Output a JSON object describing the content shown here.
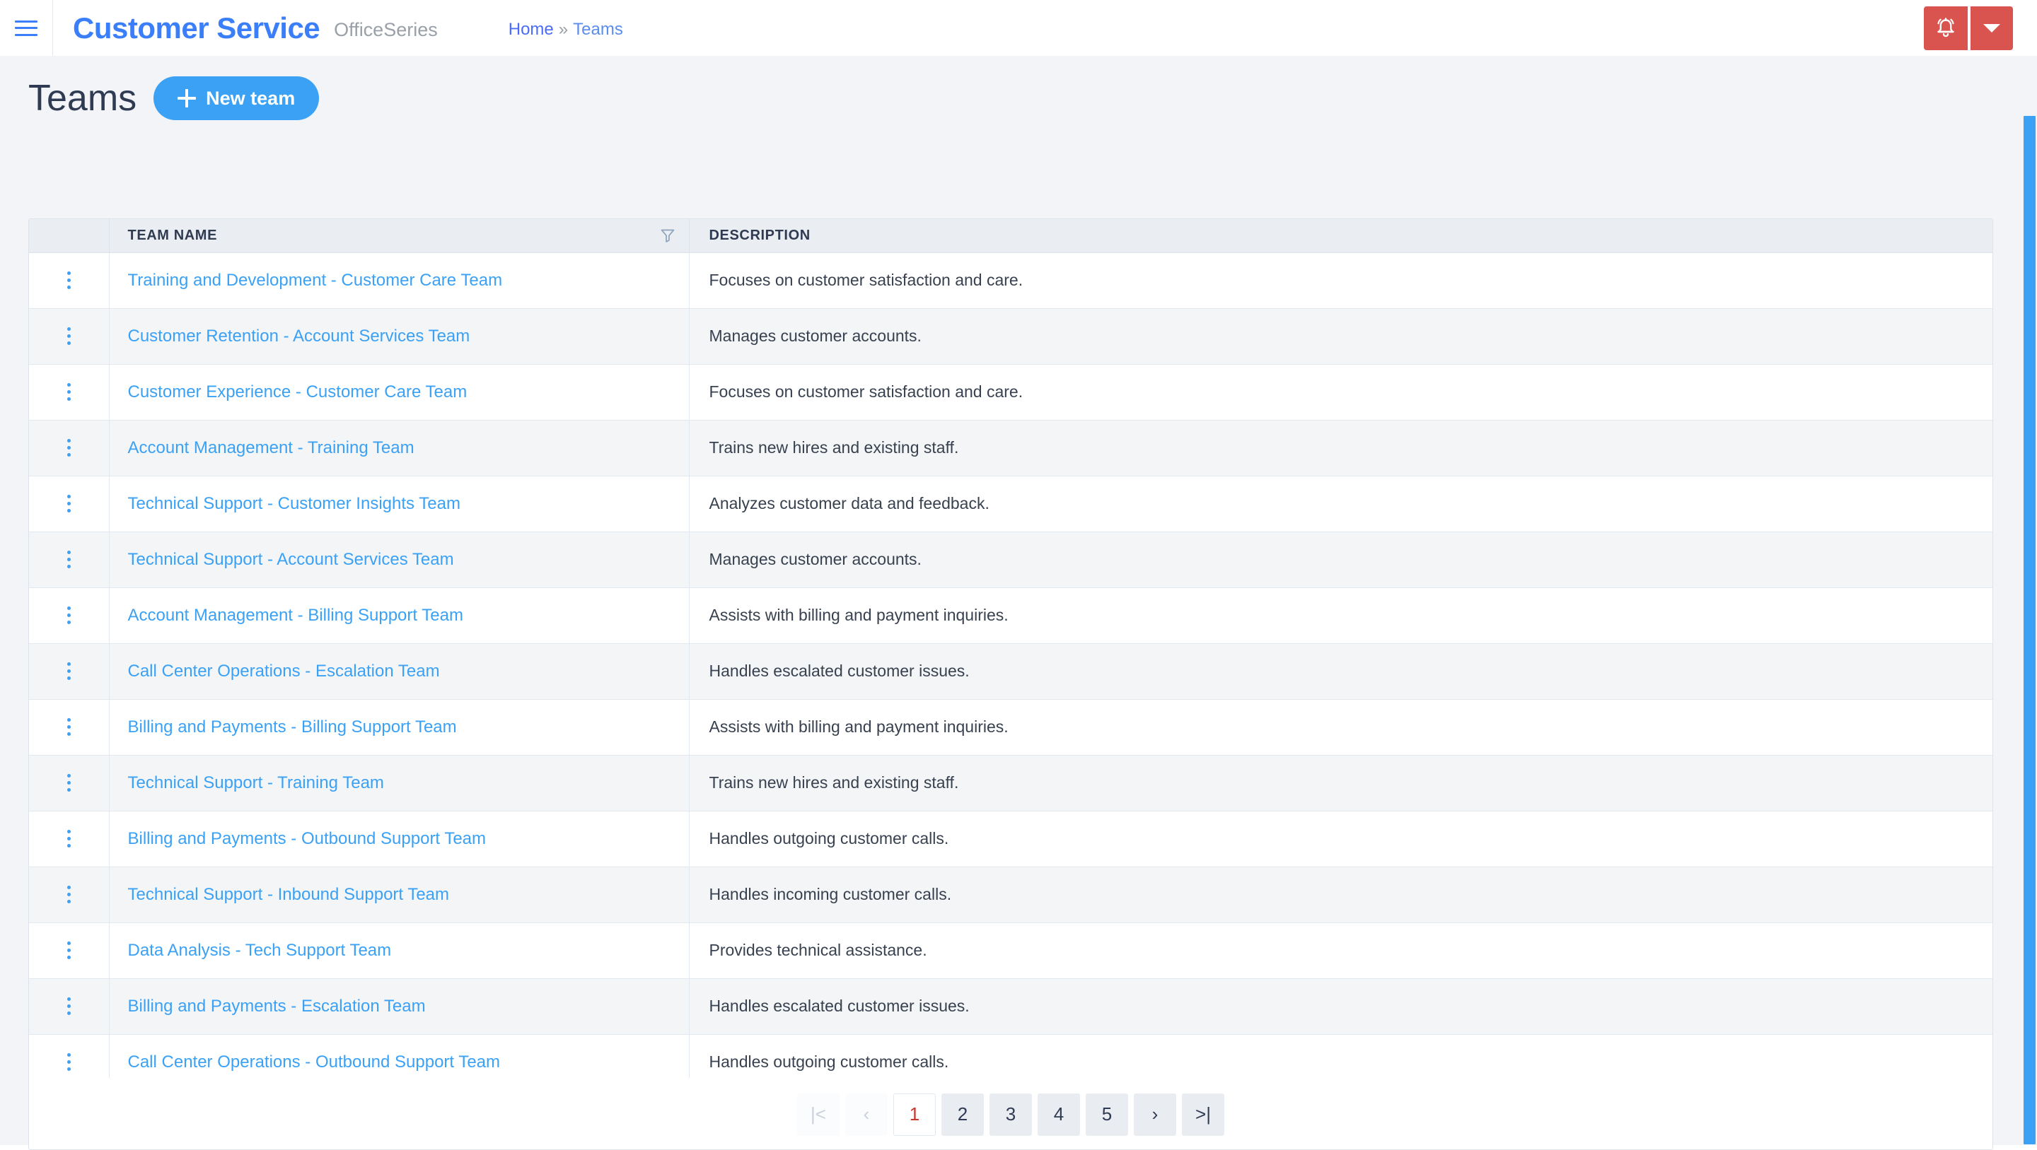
{
  "topbar": {
    "menu_icon": "hamburger-icon",
    "brand": "Customer Service",
    "brand_suffix": "OfficeSeries",
    "breadcrumb": {
      "home": "Home",
      "separator": "»",
      "current": "Teams"
    },
    "notification_icon": "bell-icon",
    "dropdown_icon": "chevron-down-icon",
    "accent_red": "#d9534f",
    "accent_blue": "#3b7ef9"
  },
  "page": {
    "title": "Teams",
    "new_button": "New team",
    "new_button_icon": "plus-icon",
    "accent_blue": "#3ba1f5",
    "background": "#f2f4f7"
  },
  "table": {
    "columns": [
      "",
      "TEAM NAME",
      "DESCRIPTION"
    ],
    "filter_icon": "filter-icon",
    "row_menu_icon": "kebab-menu-icon",
    "rows": [
      {
        "name": "Training and Development - Customer Care Team",
        "description": "Focuses on customer satisfaction and care."
      },
      {
        "name": "Customer Retention - Account Services Team",
        "description": "Manages customer accounts."
      },
      {
        "name": "Customer Experience - Customer Care Team",
        "description": "Focuses on customer satisfaction and care."
      },
      {
        "name": "Account Management - Training Team",
        "description": "Trains new hires and existing staff."
      },
      {
        "name": "Technical Support - Customer Insights Team",
        "description": "Analyzes customer data and feedback."
      },
      {
        "name": "Technical Support - Account Services Team",
        "description": "Manages customer accounts."
      },
      {
        "name": "Account Management - Billing Support Team",
        "description": "Assists with billing and payment inquiries."
      },
      {
        "name": "Call Center Operations - Escalation Team",
        "description": "Handles escalated customer issues."
      },
      {
        "name": "Billing and Payments - Billing Support Team",
        "description": "Assists with billing and payment inquiries."
      },
      {
        "name": "Technical Support - Training Team",
        "description": "Trains new hires and existing staff."
      },
      {
        "name": "Billing and Payments - Outbound Support Team",
        "description": "Handles outgoing customer calls."
      },
      {
        "name": "Technical Support - Inbound Support Team",
        "description": "Handles incoming customer calls."
      },
      {
        "name": "Data Analysis - Tech Support Team",
        "description": "Provides technical assistance."
      },
      {
        "name": "Billing and Payments - Escalation Team",
        "description": "Handles escalated customer issues."
      },
      {
        "name": "Call Center Operations - Outbound Support Team",
        "description": "Handles outgoing customer calls."
      }
    ]
  },
  "pagination": {
    "first": "|<",
    "prev": "‹",
    "pages": [
      "1",
      "2",
      "3",
      "4",
      "5"
    ],
    "current_page": "1",
    "next": "›",
    "last": ">|",
    "active_color": "#c9362c"
  },
  "scrollbar": {
    "thumb_color": "#3ba1f5"
  }
}
